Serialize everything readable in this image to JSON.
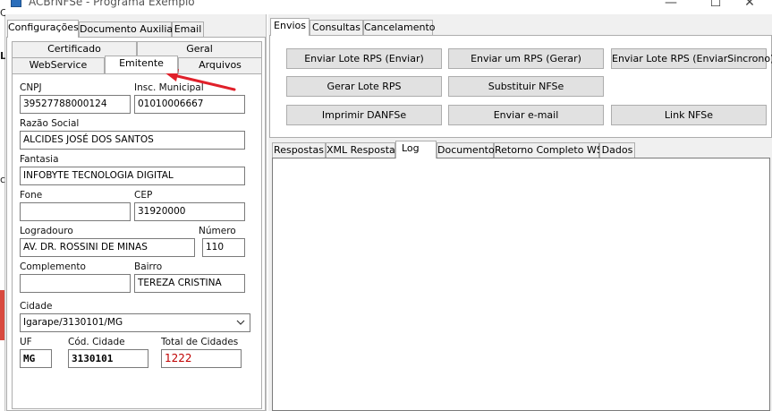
{
  "window": {
    "title": "ACBrNFSe - Programa Exemplo",
    "minimize": "—",
    "maximize": "☐",
    "close": "✕"
  },
  "left_sliver": [
    "C",
    "L",
    "co"
  ],
  "left_tabs": [
    "Configurações",
    "Documento Auxiliar",
    "Email"
  ],
  "sub_tabs_row1": [
    "Certificado",
    "Geral"
  ],
  "sub_tabs_row2": [
    "WebService",
    "Emitente",
    "Arquivos"
  ],
  "emitente": {
    "cnpj_label": "CNPJ",
    "cnpj": "39527788000124",
    "im_label": "Insc. Municipal",
    "im": "01010006667",
    "razao_label": "Razão Social",
    "razao": "ALCIDES JOSÉ DOS SANTOS",
    "fantasia_label": "Fantasia",
    "fantasia": "INFOBYTE TECNOLOGIA DIGITAL",
    "fone_label": "Fone",
    "fone": "",
    "cep_label": "CEP",
    "cep": "31920000",
    "logradouro_label": "Logradouro",
    "logradouro": "AV. DR. ROSSINI DE MINAS",
    "numero_label": "Número",
    "numero": "110",
    "complemento_label": "Complemento",
    "complemento": "",
    "bairro_label": "Bairro",
    "bairro": "TEREZA CRISTINA",
    "cidade_label": "Cidade",
    "cidade": "Igarape/3130101/MG",
    "uf_label": "UF",
    "uf": "MG",
    "cod_cidade_label": "Cód. Cidade",
    "cod_cidade": "3130101",
    "total_cidades_label": "Total de Cidades",
    "total_cidades": "1222",
    "total_cidades_color": "#c00000"
  },
  "right_tabs": [
    "Envios",
    "Consultas",
    "Cancelamento"
  ],
  "buttons": [
    "Enviar Lote RPS (Enviar)",
    "Enviar um RPS (Gerar)",
    "Enviar Lote RPS (EnviarSincrono)",
    "Gerar Lote RPS",
    "Substituir NFSe",
    "Imprimir DANFSe",
    "Enviar e-mail",
    "Link NFSe"
  ],
  "result_tabs": [
    "Respostas",
    "XML Resposta",
    "Log",
    "Documento",
    "Retorno Completo WS",
    "Dados"
  ],
  "annotation_arrow_color": "#e0202a"
}
